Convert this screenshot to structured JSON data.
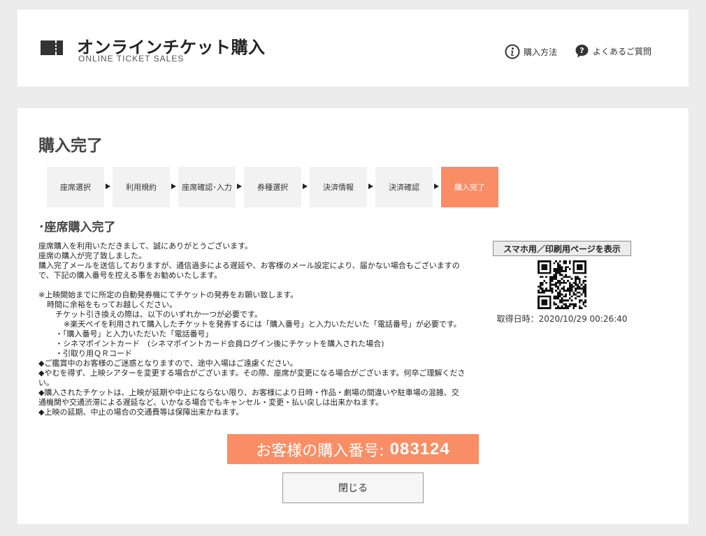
{
  "header": {
    "title": "オンラインチケット購入",
    "subtitle": "ONLINE TICKET SALES",
    "links": [
      {
        "icon": "info-circle-icon",
        "label": "購入方法"
      },
      {
        "icon": "question-bubble-icon",
        "label": "よくあるご質問"
      }
    ]
  },
  "main": {
    "page_title": "購入完了",
    "steps": [
      "座席選択",
      "利用規約",
      "座席確認･入力",
      "券種選択",
      "決済情報",
      "決済確認",
      "購入完了"
    ],
    "active_step": 6,
    "section_heading": "･座席購入完了",
    "body_lines": [
      "座席購入を利用いただきまして、誠にありがとうございます。",
      "座席の購入が完了致しました。",
      "購入完了メールを送信しておりますが、通信過多による遅延や、お客様のメール設定により、届かない場合もございますので、下記の購入番号を控える事をお勧めいたします。",
      "",
      "※上映開始までに所定の自動発券機にてチケットの発券をお願い致します。",
      "時間に余裕をもってお越しください。",
      "チケット引き換えの際は、以下のいずれか一つが必要です。",
      "※楽天ペイを利用されて購入したチケットを発券するには「購入番号」と入力いただいた「電話番号」が必要です。",
      "・「購入番号」と入力いただいた「電話番号」",
      "・シネマポイントカード　(シネマポイントカード会員ログイン後にチケットを購入された場合)",
      "・引取り用ＱＲコード",
      "◆ご鑑賞中のお客様のご迷惑となりますので、途中入場はご遠慮ください。",
      "◆やむを得ず、上映シアターを変更する場合がございます。その際、座席が変更になる場合がございます。何卒ご理解ください。",
      "◆購入されたチケットは、上映が延期や中止にならない限り、お客様により日時・作品・劇場の間違いや駐車場の混雑、交通機関や交通渋滞による遅延など、いかなる場合でもキャンセル・変更・払い戻しは出来かねます。",
      "◆上映の延期、中止の場合の交通費等は保障出来かねます。"
    ],
    "show_page_button": "スマホ用／印刷用ページを表示",
    "timestamp": "取得日時：2020/10/29 00:26:40",
    "purchase_number_label": "お客様の購入番号:",
    "purchase_number": "083124",
    "close_button": "閉じる"
  },
  "colors": {
    "accent": "#f98d65",
    "background": "#ececec",
    "step_inactive": "#f2f2f2"
  }
}
